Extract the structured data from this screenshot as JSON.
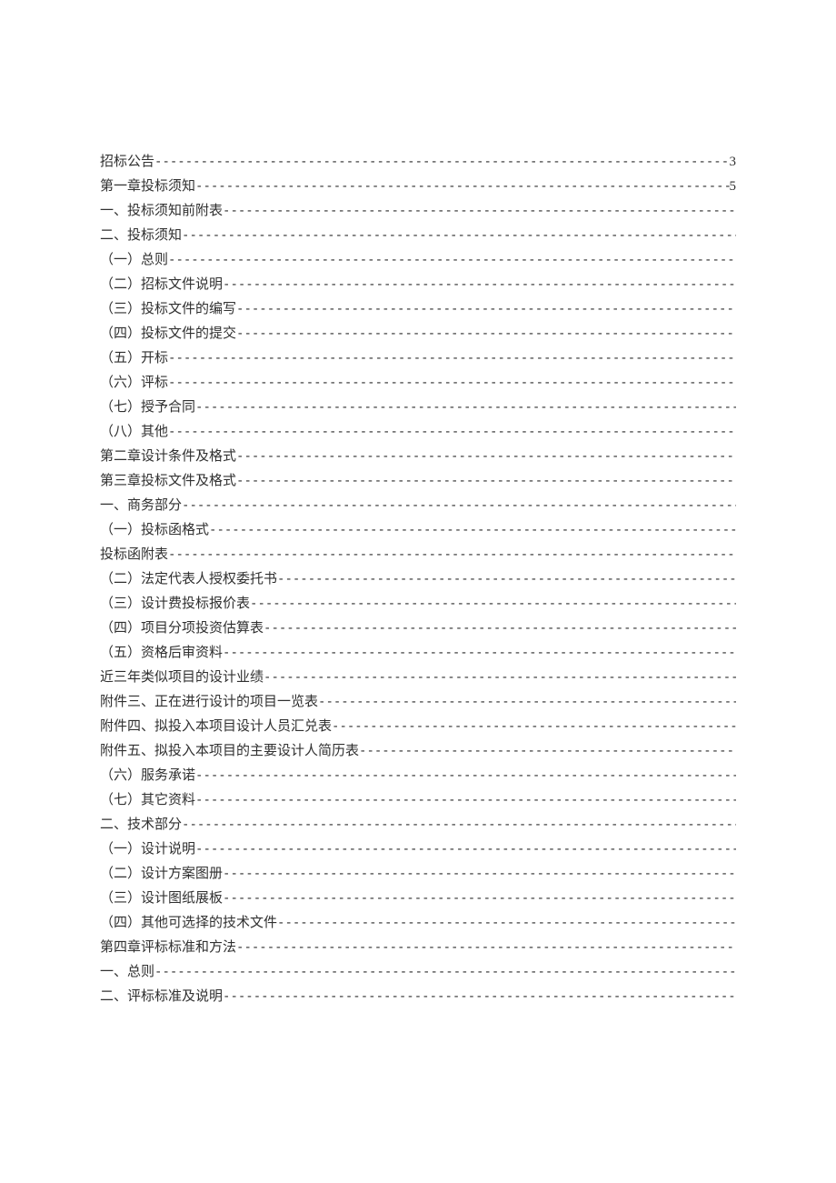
{
  "toc": [
    {
      "title": "招标公告",
      "page": "3"
    },
    {
      "title": "第一章投标须知",
      "page": "5"
    },
    {
      "title": "一、投标须知前附表",
      "page": ""
    },
    {
      "title": "二、投标须知",
      "page": ""
    },
    {
      "title": "（一）总则",
      "page": ""
    },
    {
      "title": "（二）招标文件说明",
      "page": ""
    },
    {
      "title": "（三）投标文件的编写",
      "page": ""
    },
    {
      "title": "（四）投标文件的提交",
      "page": ""
    },
    {
      "title": "（五）开标",
      "page": ""
    },
    {
      "title": "（六）评标",
      "page": ""
    },
    {
      "title": "（七）授予合同",
      "page": ""
    },
    {
      "title": "（八）其他",
      "page": ""
    },
    {
      "title": "第二章设计条件及格式",
      "page": ""
    },
    {
      "title": "第三章投标文件及格式",
      "page": ""
    },
    {
      "title": "一、商务部分",
      "page": ""
    },
    {
      "title": "（一）投标函格式",
      "page": ""
    },
    {
      "title": "投标函附表",
      "page": ""
    },
    {
      "title": "（二）法定代表人授权委托书",
      "page": ""
    },
    {
      "title": "（三）设计费投标报价表",
      "page": ""
    },
    {
      "title": "（四）项目分项投资估算表",
      "page": ""
    },
    {
      "title": "（五）资格后审资料",
      "page": ""
    },
    {
      "title": "近三年类似项目的设计业绩",
      "page": ""
    },
    {
      "title": "附件三、正在进行设计的项目一览表",
      "page": ""
    },
    {
      "title": "附件四、拟投入本项目设计人员汇兑表",
      "page": ""
    },
    {
      "title": "附件五、拟投入本项目的主要设计人简历表",
      "page": ""
    },
    {
      "title": "（六）服务承诺",
      "page": ""
    },
    {
      "title": "（七）其它资料",
      "page": ""
    },
    {
      "title": "二、技术部分",
      "page": ""
    },
    {
      "title": "（一）设计说明",
      "page": ""
    },
    {
      "title": "（二）设计方案图册",
      "page": ""
    },
    {
      "title": "（三）设计图纸展板",
      "page": ""
    },
    {
      "title": "（四）其他可选择的技术文件",
      "page": ""
    },
    {
      "title": "第四章评标标准和方法",
      "page": ""
    },
    {
      "title": "一、总则",
      "page": ""
    },
    {
      "title": "二、评标标准及说明",
      "page": ""
    }
  ]
}
